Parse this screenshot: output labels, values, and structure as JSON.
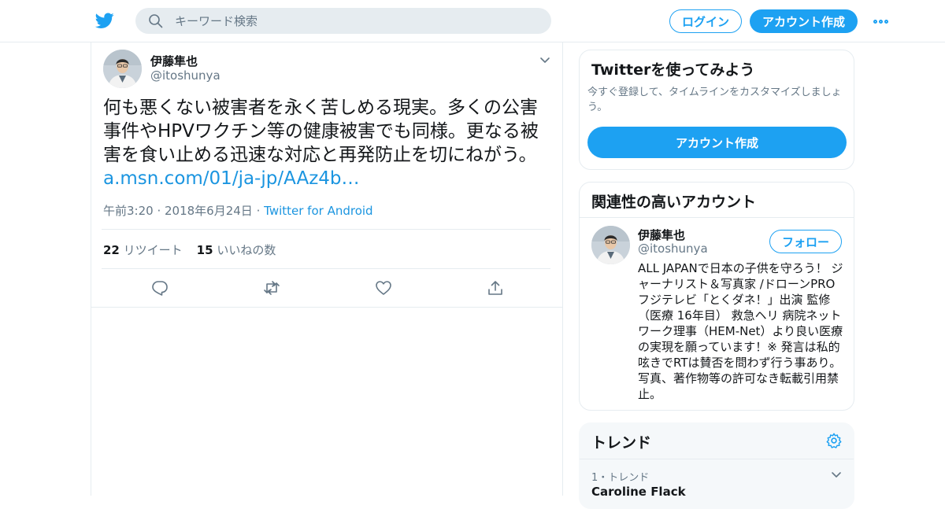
{
  "header": {
    "search_placeholder": "キーワード検索",
    "login_label": "ログイン",
    "signup_label": "アカウント作成"
  },
  "tweet": {
    "author_name": "伊藤隼也",
    "author_handle": "@itoshunya",
    "text": "何も悪くない被害者を永く苦しめる現実。多くの公害事件やHPVワクチン等の健康被害でも同様。更なる被害を食い止める迅速な対応と再発防止を切にねがう。",
    "link": "a.msn.com/01/ja-jp/AAz4b…",
    "time": "午前3:20 · 2018年6月24日",
    "separator": "·",
    "via": "Twitter for Android",
    "retweet_count": "22",
    "retweet_label": "リツイート",
    "like_count": "15",
    "like_label": "いいねの数"
  },
  "signup_card": {
    "title": "Twitterを使ってみよう",
    "description": "今すぐ登録して、タイムラインをカスタマイズしましょう。",
    "button_label": "アカウント作成"
  },
  "related_card": {
    "title": "関連性の高いアカウント",
    "name": "伊藤隼也",
    "handle": "@itoshunya",
    "follow_label": "フォロー",
    "bio": "ALL JAPANで日本の子供を守ろう！ ジャーナリスト＆写真家 /ドローンPRO フジテレビ「とくダネ！」出演 監修（医療 16年目） 救急ヘリ 病院ネットワーク理事（HEM-Net）より良い医療の実現を願っています！※ 発言は私的呟きでRTは賛否を問わず行う事あり。写真、著作物等の許可なき転載引用禁止。"
  },
  "trends_card": {
    "title": "トレンド",
    "items": [
      {
        "meta": "1・トレンド",
        "name": "Caroline Flack"
      }
    ]
  },
  "colors": {
    "accent": "#1da1f2",
    "link": "#1b95e0",
    "muted": "#657786",
    "border": "#e6ecf0"
  },
  "icons": [
    "twitter-bird-icon",
    "search-icon",
    "more-icon",
    "chevron-down-icon",
    "reply-icon",
    "retweet-icon",
    "like-icon",
    "share-icon",
    "gear-icon"
  ]
}
